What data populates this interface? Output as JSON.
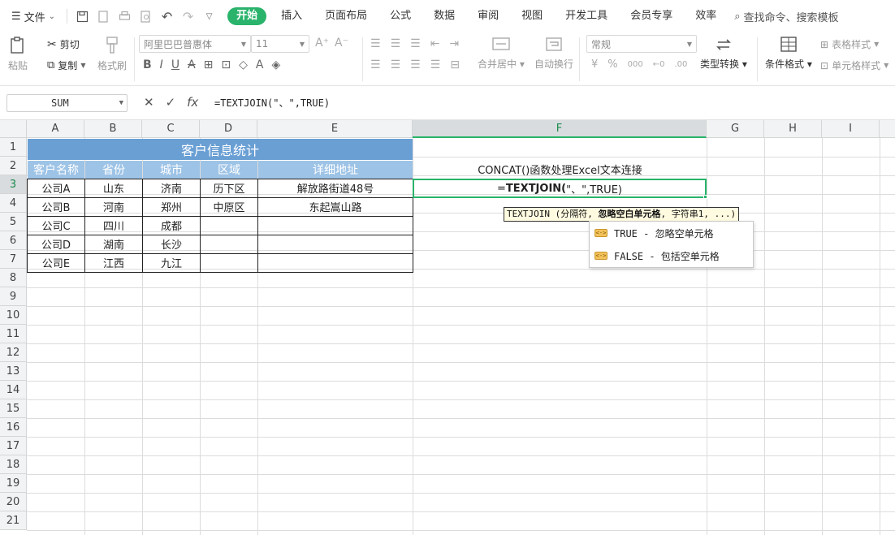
{
  "menubar": {
    "file_label": "文件",
    "tabs": [
      {
        "label": "开始",
        "active": true
      },
      {
        "label": "插入"
      },
      {
        "label": "页面布局"
      },
      {
        "label": "公式"
      },
      {
        "label": "数据"
      },
      {
        "label": "审阅"
      },
      {
        "label": "视图"
      },
      {
        "label": "开发工具"
      },
      {
        "label": "会员专享"
      },
      {
        "label": "效率"
      }
    ],
    "search_label": "查找命令、搜索模板"
  },
  "ribbon": {
    "paste": "粘贴",
    "cut": "剪切",
    "copy": "复制",
    "format_painter": "格式刷",
    "font_name": "阿里巴巴普惠体",
    "font_size": "11",
    "merge_center": "合并居中",
    "wrap_text": "自动换行",
    "number_format": "常规",
    "type_convert": "类型转换",
    "cond_format": "条件格式",
    "table_style": "表格样式",
    "cell_style": "单元格样式",
    "currency_symbol": "¥",
    "percent_symbol": "%",
    "thousands_symbol": "000"
  },
  "formula_bar": {
    "name_box": "SUM",
    "formula": "=TEXTJOIN(\"、\",TRUE)"
  },
  "columns": [
    "A",
    "B",
    "C",
    "D",
    "E",
    "F",
    "G",
    "H",
    "I"
  ],
  "rows": [
    "1",
    "2",
    "3",
    "4",
    "5",
    "6",
    "7",
    "8",
    "9",
    "10",
    "11",
    "12",
    "13",
    "14",
    "15",
    "16",
    "17",
    "18",
    "19",
    "20",
    "21"
  ],
  "sheet": {
    "title": "客户信息统计",
    "headers": [
      "客户名称",
      "省份",
      "城市",
      "区域",
      "详细地址"
    ],
    "data": [
      [
        "公司A",
        "山东",
        "济南",
        "历下区",
        "解放路街道48号"
      ],
      [
        "公司B",
        "河南",
        "郑州",
        "中原区",
        "东起嵩山路"
      ],
      [
        "公司C",
        "四川",
        "成都",
        "",
        ""
      ],
      [
        "公司D",
        "湖南",
        "长沙",
        "",
        ""
      ],
      [
        "公司E",
        "江西",
        "九江",
        "",
        ""
      ]
    ],
    "f2_text": "CONCAT()函数处理Excel文本连接",
    "f3_prefix": "=",
    "f3_bold": "TEXTJOIN(",
    "f3_rest": "\"、\",TRUE)",
    "tooltip_a": "TEXTJOIN (分隔符, ",
    "tooltip_b": "忽略空白单元格",
    "tooltip_c": ", 字符串1, ...)",
    "autocomplete": [
      {
        "icon": "<->",
        "label": "TRUE - 忽略空单元格"
      },
      {
        "icon": "<->",
        "label": "FALSE - 包括空单元格"
      }
    ]
  },
  "colors": {
    "accent": "#29b36b",
    "title_band": "#6a9fd4",
    "header_band": "#9dc3e6"
  }
}
